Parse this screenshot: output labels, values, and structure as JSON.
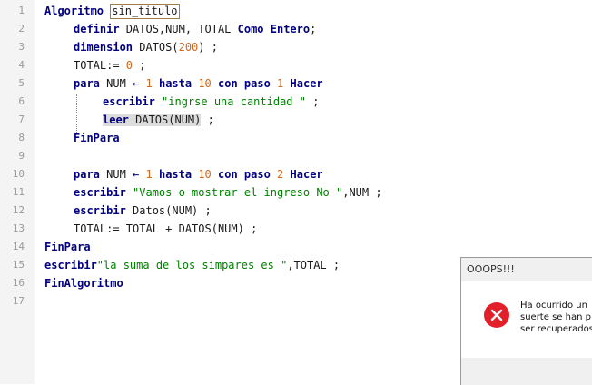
{
  "editor": {
    "lines": [
      {
        "n": "1",
        "indent": 0,
        "tokens": [
          {
            "t": "Algoritmo",
            "k": "kw"
          },
          {
            "t": " ",
            "k": "plain"
          },
          {
            "t": "sin_titulo",
            "k": "id"
          }
        ]
      },
      {
        "n": "2",
        "indent": 1,
        "tokens": [
          {
            "t": "definir",
            "k": "kw"
          },
          {
            "t": " DATOS,NUM, TOTAL ",
            "k": "plain"
          },
          {
            "t": "Como Entero",
            "k": "kw"
          },
          {
            "t": ";",
            "k": "plain"
          }
        ]
      },
      {
        "n": "3",
        "indent": 1,
        "tokens": [
          {
            "t": "dimension",
            "k": "kw"
          },
          {
            "t": " DATOS(",
            "k": "plain"
          },
          {
            "t": "200",
            "k": "num"
          },
          {
            "t": ") ;",
            "k": "plain"
          }
        ]
      },
      {
        "n": "4",
        "indent": 1,
        "tokens": [
          {
            "t": "TOTAL:= ",
            "k": "plain"
          },
          {
            "t": "0",
            "k": "num"
          },
          {
            "t": " ;",
            "k": "plain"
          }
        ]
      },
      {
        "n": "5",
        "indent": 1,
        "tokens": [
          {
            "t": "para",
            "k": "kw"
          },
          {
            "t": " NUM ",
            "k": "plain"
          },
          {
            "t": "←",
            "k": "op"
          },
          {
            "t": " ",
            "k": "plain"
          },
          {
            "t": "1",
            "k": "num"
          },
          {
            "t": " ",
            "k": "plain"
          },
          {
            "t": "hasta",
            "k": "kw"
          },
          {
            "t": " ",
            "k": "plain"
          },
          {
            "t": "10",
            "k": "num"
          },
          {
            "t": " ",
            "k": "plain"
          },
          {
            "t": "con paso",
            "k": "kw"
          },
          {
            "t": " ",
            "k": "plain"
          },
          {
            "t": "1",
            "k": "num"
          },
          {
            "t": " ",
            "k": "plain"
          },
          {
            "t": "Hacer",
            "k": "kw"
          }
        ]
      },
      {
        "n": "6",
        "indent": 2,
        "tokens": [
          {
            "t": "escribir",
            "k": "kw"
          },
          {
            "t": " ",
            "k": "plain"
          },
          {
            "t": "\"ingrse una cantidad \"",
            "k": "str"
          },
          {
            "t": " ;",
            "k": "plain"
          }
        ]
      },
      {
        "n": "7",
        "indent": 2,
        "tokens": [
          {
            "t": "leer",
            "k": "hlkw"
          },
          {
            "t": " DATOS(NUM)",
            "k": "hl"
          },
          {
            "t": " ;",
            "k": "plain"
          }
        ]
      },
      {
        "n": "8",
        "indent": 1,
        "tokens": [
          {
            "t": "FinPara",
            "k": "kw"
          }
        ]
      },
      {
        "n": "9",
        "indent": 0,
        "tokens": []
      },
      {
        "n": "10",
        "indent": 1,
        "tokens": [
          {
            "t": "para",
            "k": "kw"
          },
          {
            "t": " NUM ",
            "k": "plain"
          },
          {
            "t": "←",
            "k": "op"
          },
          {
            "t": " ",
            "k": "plain"
          },
          {
            "t": "1",
            "k": "num"
          },
          {
            "t": " ",
            "k": "plain"
          },
          {
            "t": "hasta",
            "k": "kw"
          },
          {
            "t": " ",
            "k": "plain"
          },
          {
            "t": "10",
            "k": "num"
          },
          {
            "t": " ",
            "k": "plain"
          },
          {
            "t": "con paso",
            "k": "kw"
          },
          {
            "t": " ",
            "k": "plain"
          },
          {
            "t": "2",
            "k": "num"
          },
          {
            "t": " ",
            "k": "plain"
          },
          {
            "t": "Hacer",
            "k": "kw"
          }
        ]
      },
      {
        "n": "11",
        "indent": 1,
        "tokens": [
          {
            "t": "escribir",
            "k": "kw"
          },
          {
            "t": " ",
            "k": "plain"
          },
          {
            "t": "\"Vamos o mostrar el ingreso No \"",
            "k": "str"
          },
          {
            "t": ",NUM ;",
            "k": "plain"
          }
        ]
      },
      {
        "n": "12",
        "indent": 1,
        "tokens": [
          {
            "t": "escribir",
            "k": "kw"
          },
          {
            "t": " Datos(NUM) ;",
            "k": "plain"
          }
        ]
      },
      {
        "n": "13",
        "indent": 1,
        "tokens": [
          {
            "t": "TOTAL:= TOTAL + DATOS(NUM) ;",
            "k": "plain"
          }
        ]
      },
      {
        "n": "14",
        "indent": 0,
        "tokens": [
          {
            "t": "FinPara",
            "k": "kw"
          }
        ]
      },
      {
        "n": "15",
        "indent": 0,
        "tokens": [
          {
            "t": "escribir",
            "k": "kw"
          },
          {
            "t": "\"la suma de los simpares es \"",
            "k": "str"
          },
          {
            "t": ",TOTAL ;",
            "k": "plain"
          }
        ]
      },
      {
        "n": "16",
        "indent": 0,
        "tokens": [
          {
            "t": "FinAlgoritmo",
            "k": "kw"
          }
        ]
      },
      {
        "n": "17",
        "indent": 0,
        "tokens": []
      }
    ]
  },
  "dialog": {
    "title": "OOOPS!!!",
    "message": "Ha ocurrido un\nsuerte se han p\nser recuperados",
    "icon": "error-icon",
    "icon_color": "#e3202a"
  }
}
